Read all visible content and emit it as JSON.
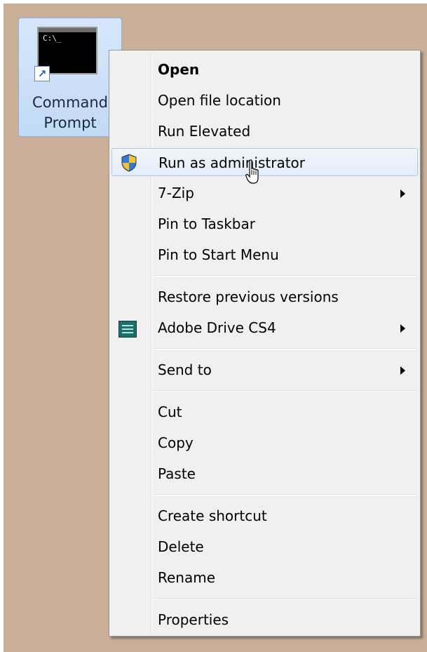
{
  "desktop": {
    "icon": {
      "label_line1": "Command",
      "label_line2": "Prompt",
      "console_text": "C:\\_"
    }
  },
  "context_menu": {
    "items": [
      {
        "label": "Open",
        "bold": true
      },
      {
        "label": "Open file location"
      },
      {
        "label": "Run Elevated"
      },
      {
        "label": "Run as administrator",
        "icon": "uac-shield-icon",
        "highlighted": true
      },
      {
        "label": "7-Zip",
        "submenu": true
      },
      {
        "label": "Pin to Taskbar"
      },
      {
        "label": "Pin to Start Menu"
      },
      {
        "label": "Restore previous versions"
      },
      {
        "label": "Adobe Drive CS4",
        "icon": "adobe-drive-icon",
        "submenu": true
      },
      {
        "label": "Send to",
        "submenu": true
      },
      {
        "label": "Cut"
      },
      {
        "label": "Copy"
      },
      {
        "label": "Paste"
      },
      {
        "label": "Create shortcut"
      },
      {
        "label": "Delete"
      },
      {
        "label": "Rename"
      },
      {
        "label": "Properties"
      }
    ]
  },
  "colors": {
    "desktop_bg": "#c9af97",
    "menu_bg": "#f0f0f0",
    "highlight_border": "#a8c8ec"
  }
}
